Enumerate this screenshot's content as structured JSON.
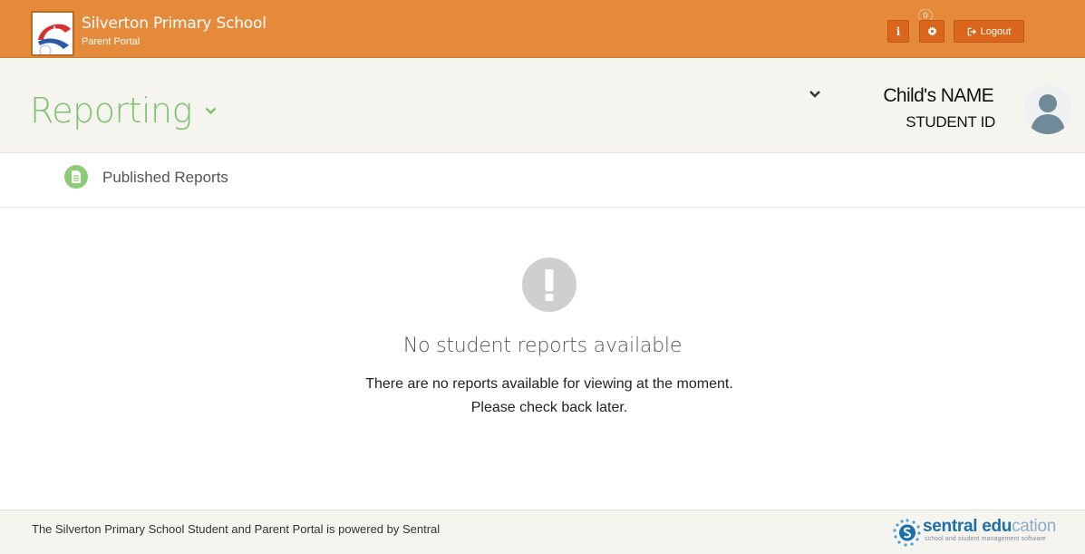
{
  "topbar": {
    "school_name": "Silverton Primary School",
    "portal_name": "Parent Portal",
    "info_label": "i",
    "notification_count": "0",
    "logout_label": "Logout",
    "bar_color": "#e48a3a",
    "button_color": "#d9661b"
  },
  "header": {
    "page_title": "Reporting",
    "child_name": "Child's NAME",
    "student_id": "STUDENT ID",
    "title_color": "#7cc36e"
  },
  "tabs": [
    {
      "label": "Published Reports",
      "icon": "document-icon",
      "active": true
    }
  ],
  "empty_state": {
    "icon": "exclamation-icon",
    "title": "No student reports available",
    "line1": "There are no reports available for viewing at the moment.",
    "line2": "Please check back later."
  },
  "footer": {
    "text": "The Silverton Primary School Student and Parent Portal is powered by Sentral",
    "brand_bold": "sentral",
    "brand_edu": "edu",
    "brand_cation": "cation",
    "brand_tagline": "school and student management software",
    "brand_color": "#1d6fa9"
  }
}
